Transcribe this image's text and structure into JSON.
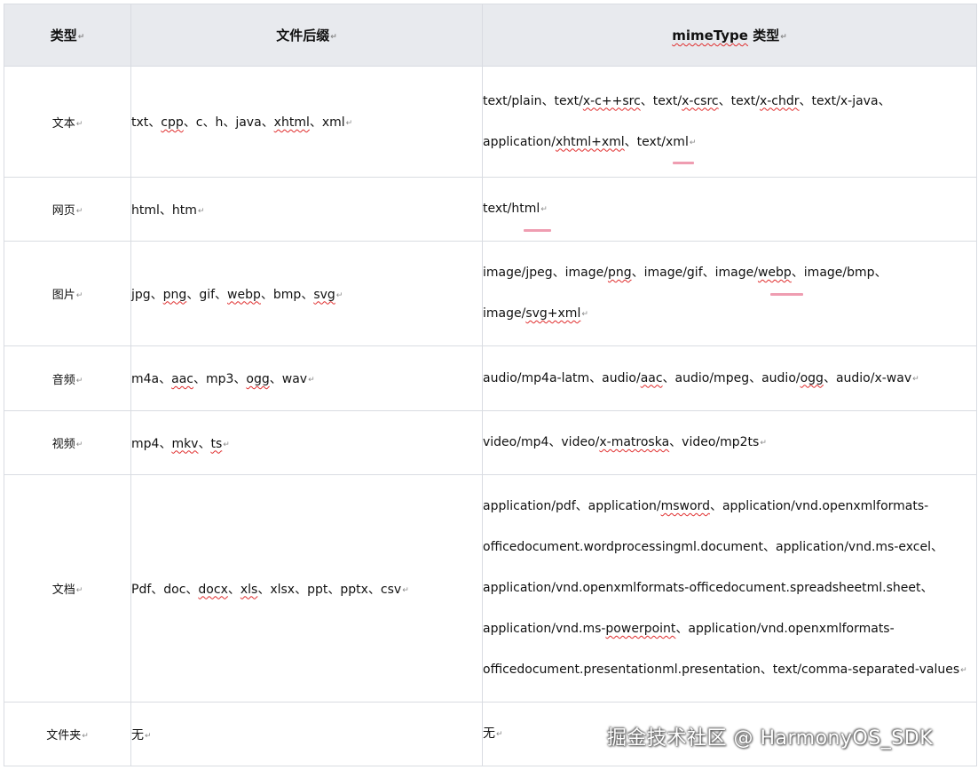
{
  "table": {
    "headers": {
      "type": "类型",
      "ext": "文件后缀",
      "mime_prefix": "mimeType",
      "mime_suffix": " 类型"
    },
    "rows": [
      {
        "type": "文本",
        "ext": [
          "txt",
          "cpp",
          "c",
          "h",
          "java",
          "xhtml",
          "xml"
        ],
        "mime_lines": [
          [
            "text/plain",
            "text/x-c++src",
            "text/x-csrc",
            "text/x-chdr",
            "text/x-java"
          ],
          [
            "application/xhtml+xml",
            "text/xml"
          ]
        ]
      },
      {
        "type": "网页",
        "ext": [
          "html",
          "htm"
        ],
        "mime_lines": [
          [
            "text/html"
          ]
        ]
      },
      {
        "type": "图片",
        "ext": [
          "jpg",
          "png",
          "gif",
          "webp",
          "bmp",
          "svg"
        ],
        "mime_lines": [
          [
            "image/jpeg",
            "image/png",
            "image/gif",
            "image/webp",
            "image/bmp"
          ],
          [
            "image/svg+xml"
          ]
        ]
      },
      {
        "type": "音频",
        "ext": [
          "m4a",
          "aac",
          "mp3",
          "ogg",
          "wav"
        ],
        "mime_lines": [
          [
            "audio/mp4a-latm",
            "audio/aac",
            "audio/mpeg",
            "audio/ogg",
            "audio/x-wav"
          ]
        ]
      },
      {
        "type": "视频",
        "ext": [
          "mp4",
          "mkv",
          "ts"
        ],
        "mime_lines": [
          [
            "video/mp4",
            "video/x-matroska",
            "video/mp2ts"
          ]
        ]
      },
      {
        "type": "文档",
        "ext": [
          "Pdf",
          "doc",
          "docx",
          "xls",
          "xlsx",
          "ppt",
          "pptx",
          "csv"
        ],
        "mime_lines": [
          [
            "application/pdf",
            "application/msword",
            "application/vnd.openxmlformats-"
          ],
          [
            "officedocument.wordprocessingml.document",
            "application/vnd.ms-excel"
          ],
          [
            "application/vnd.openxmlformats-officedocument.spreadsheetml.sheet"
          ],
          [
            "application/vnd.ms-powerpoint",
            "application/vnd.openxmlformats-"
          ],
          [
            "officedocument.presentationml.presentation",
            "text/comma-separated-values"
          ]
        ]
      },
      {
        "type": "文件夹",
        "ext": [
          "无"
        ],
        "mime_lines": [
          [
            "无"
          ]
        ]
      }
    ]
  },
  "separator": "、",
  "paragraph_mark": "↵",
  "watermark": "掘金技术社区 @ HarmonyOS_SDK",
  "colors": {
    "header_bg": "#e8eaee",
    "border": "#d9dce2",
    "squiggle": "#e02d2d",
    "pink_mark": "#ef9db1"
  }
}
